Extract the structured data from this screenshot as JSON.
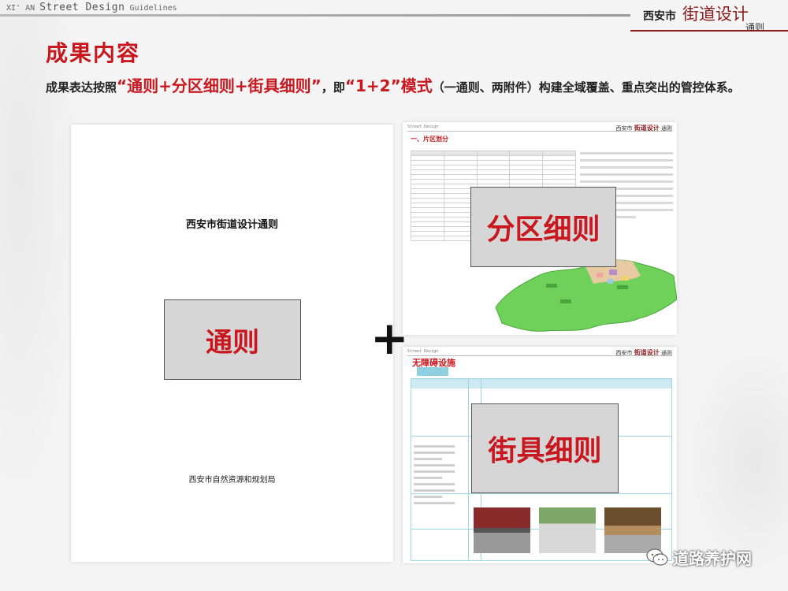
{
  "header": {
    "left_prefix": "XI' AN",
    "left_brand": "Street Design",
    "left_suffix": "Guidelines",
    "right_city": "西安市",
    "right_title": "街道设计",
    "right_sub": "通则"
  },
  "title": "成果内容",
  "paragraph": {
    "part1": "成果表达按照",
    "quote1": "“通则+分区细则+街具细则”",
    "part2": "，即",
    "quote2": "“1+2”模式",
    "part3": "（一通则、两附件）构建全域覆盖、重点突出的管控体系。"
  },
  "doc": {
    "title": "西安市街道设计通则",
    "box_label": "通则",
    "footer": "西安市自然资源和规划局"
  },
  "plus": "+",
  "zone_card": {
    "mini_header_left": "Street Design",
    "mini_header_city": "西安市",
    "mini_header_title": "街道设计",
    "mini_header_sub": "通则",
    "section": "一、片区划分",
    "box_label": "分区细则"
  },
  "furniture_card": {
    "section": "无障碍设施",
    "box_label": "街具细则"
  },
  "watermark": "道路养护网",
  "colors": {
    "accent_red": "#c8171e",
    "brand_dark_red": "#8a1c1c",
    "table_blue": "#9fd6e6",
    "map_green": "#6fd15a"
  }
}
